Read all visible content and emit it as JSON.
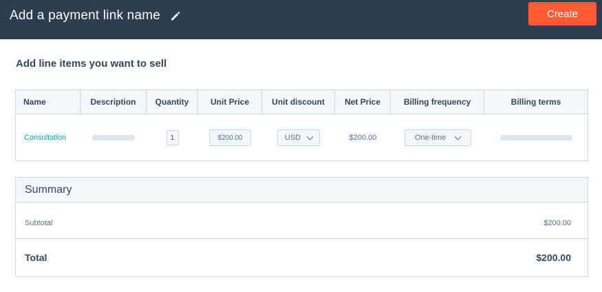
{
  "header": {
    "title": "Add a payment link name",
    "create_label": "Create",
    "edit_icon": "pencil-icon"
  },
  "section_heading": "Add line items you want to sell",
  "table": {
    "columns": [
      "Name",
      "Description",
      "Quantity",
      "Unit Price",
      "Unit discount",
      "Net Price",
      "Billing frequency",
      "Billing terms"
    ],
    "row": {
      "name": "Consultation",
      "quantity": "1",
      "unit_price": "$200.00",
      "discount_currency": "USD",
      "net_price": "$200.00",
      "billing_frequency": "One-time"
    }
  },
  "summary": {
    "title": "Summary",
    "subtotal_label": "Subtotal",
    "subtotal_value": "$200.00",
    "total_label": "Total",
    "total_value": "$200.00"
  },
  "colors": {
    "header_bg": "#2d3e50",
    "accent": "#ff5c35",
    "link": "#00a4bd",
    "border": "#cbd6e2"
  }
}
